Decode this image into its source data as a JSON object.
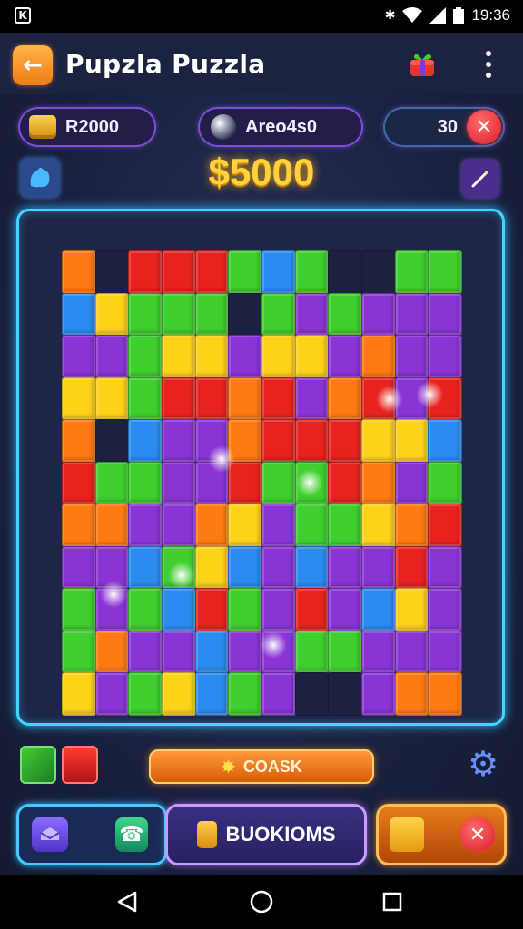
{
  "status_bar": {
    "time": "19:36",
    "icons": [
      "app-notification-icon",
      "bluetooth-icon",
      "wifi-icon",
      "signal-icon",
      "battery-icon"
    ]
  },
  "app_bar": {
    "title": "Pupzla Puzzla",
    "back_icon": "arrow-left-icon",
    "gift_icon": "gift-icon",
    "menu_icon": "more-vertical-icon"
  },
  "currencies": {
    "coins_value": "R2000",
    "orbs_value": "Areo4s0",
    "lives_value": "30"
  },
  "score": "$5000",
  "board": {
    "colors": {
      "orange": "#ff7a12",
      "red": "#e8231f",
      "green": "#3fcf2e",
      "blue": "#2a8cf0",
      "purple": "#8a34d6",
      "yellow": "#ffd21a",
      "dark": "#1c2140"
    },
    "rows": [
      [
        "orange",
        "dark",
        "red",
        "red",
        "red",
        "green",
        "blue",
        "green",
        "dark",
        "dark",
        "green",
        "green"
      ],
      [
        "blue",
        "yellow",
        "green",
        "green",
        "green",
        "dark",
        "green",
        "purple",
        "green",
        "purple",
        "purple",
        "purple"
      ],
      [
        "purple",
        "purple",
        "green",
        "yellow",
        "yellow",
        "purple",
        "yellow",
        "yellow",
        "purple",
        "orange",
        "purple",
        "purple"
      ],
      [
        "yellow",
        "yellow",
        "green",
        "red",
        "red",
        "orange",
        "red",
        "purple",
        "orange",
        "red",
        "purple",
        "red"
      ],
      [
        "orange",
        "dark",
        "blue",
        "purple",
        "purple",
        "orange",
        "red",
        "red",
        "red",
        "yellow",
        "yellow",
        "blue"
      ],
      [
        "red",
        "green",
        "green",
        "purple",
        "purple",
        "red",
        "green",
        "green",
        "red",
        "orange",
        "purple",
        "green"
      ],
      [
        "orange",
        "orange",
        "purple",
        "purple",
        "orange",
        "yellow",
        "purple",
        "green",
        "green",
        "yellow",
        "orange",
        "red"
      ],
      [
        "purple",
        "purple",
        "blue",
        "green",
        "yellow",
        "blue",
        "purple",
        "blue",
        "purple",
        "purple",
        "red",
        "purple"
      ],
      [
        "green",
        "purple",
        "green",
        "blue",
        "red",
        "green",
        "purple",
        "red",
        "purple",
        "blue",
        "yellow",
        "purple"
      ],
      [
        "green",
        "orange",
        "purple",
        "purple",
        "blue",
        "purple",
        "purple",
        "green",
        "green",
        "purple",
        "purple",
        "purple"
      ],
      [
        "yellow",
        "purple",
        "green",
        "yellow",
        "blue",
        "green",
        "purple",
        "dark",
        "dark",
        "purple",
        "orange",
        "orange"
      ]
    ]
  },
  "tools": {
    "pencil_icon": "pencil-icon",
    "box_icon": "red-box-icon",
    "action_label": "COASK",
    "settings_icon": "gear-icon"
  },
  "bottom_bar": {
    "left_icon_1": "shield-icon",
    "left_icon_2": "phone-icon",
    "middle_label": "BUOKIOMS",
    "right_icon": "cube-icon",
    "close_icon": "close-icon"
  },
  "nav": {
    "back": "triangle-back-icon",
    "home": "circle-home-icon",
    "recents": "square-recents-icon"
  }
}
